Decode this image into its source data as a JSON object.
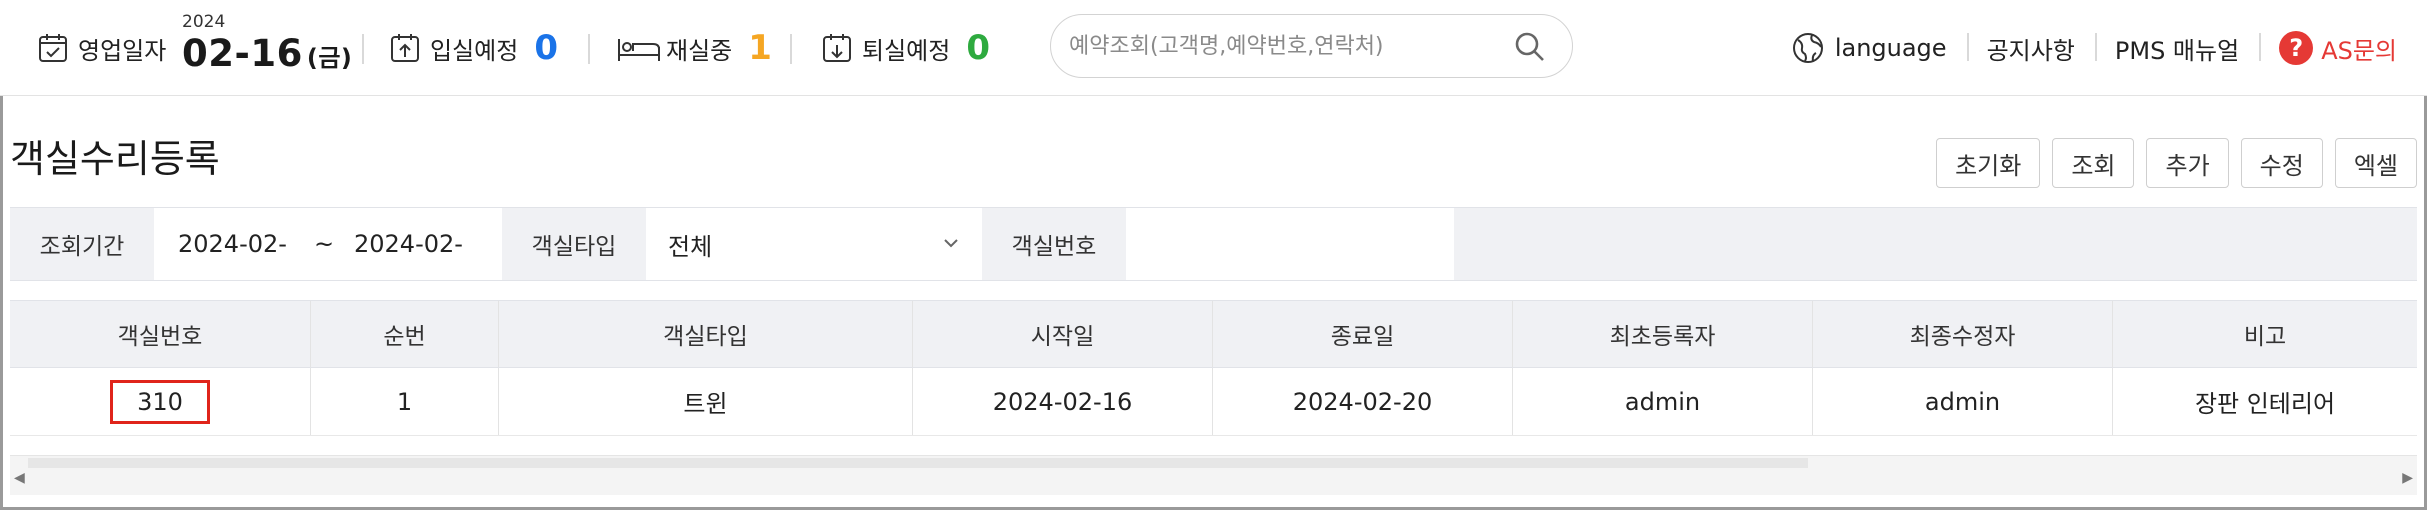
{
  "header": {
    "business_date_label": "영업일자",
    "business_year": "2024",
    "business_date": "02-16",
    "business_day": "(금)",
    "checkin_label": "입실예정",
    "checkin_count": "0",
    "occupied_label": "재실중",
    "occupied_count": "1",
    "checkout_label": "퇴실예정",
    "checkout_count": "0",
    "search_placeholder": "예약조회(고객명,예약번호,연락처)",
    "language_label": "language",
    "notice_label": "공지사항",
    "manual_label": "PMS 매뉴얼",
    "as_label": "AS문의",
    "colors": {
      "checkin": "#1a73e8",
      "occupied": "#f5a623",
      "checkout": "#2eaa3f",
      "as": "#e53935"
    }
  },
  "page": {
    "title": "객실수리등록",
    "buttons": {
      "reset": "초기화",
      "search": "조회",
      "add": "추가",
      "edit": "수정",
      "excel": "엑셀"
    }
  },
  "filter": {
    "period_label": "조회기간",
    "date_from": "2024-02-",
    "date_sep": "~",
    "date_to": "2024-02-",
    "room_type_label": "객실타입",
    "room_type_value": "전체",
    "room_no_label": "객실번호",
    "room_no_value": ""
  },
  "table": {
    "columns": [
      "객실번호",
      "순번",
      "객실타입",
      "시작일",
      "종료일",
      "최초등록자",
      "최종수정자",
      "비고"
    ],
    "rows": [
      [
        "310",
        "1",
        "트윈",
        "2024-02-16",
        "2024-02-20",
        "admin",
        "admin",
        "장판 인테리어"
      ]
    ]
  }
}
